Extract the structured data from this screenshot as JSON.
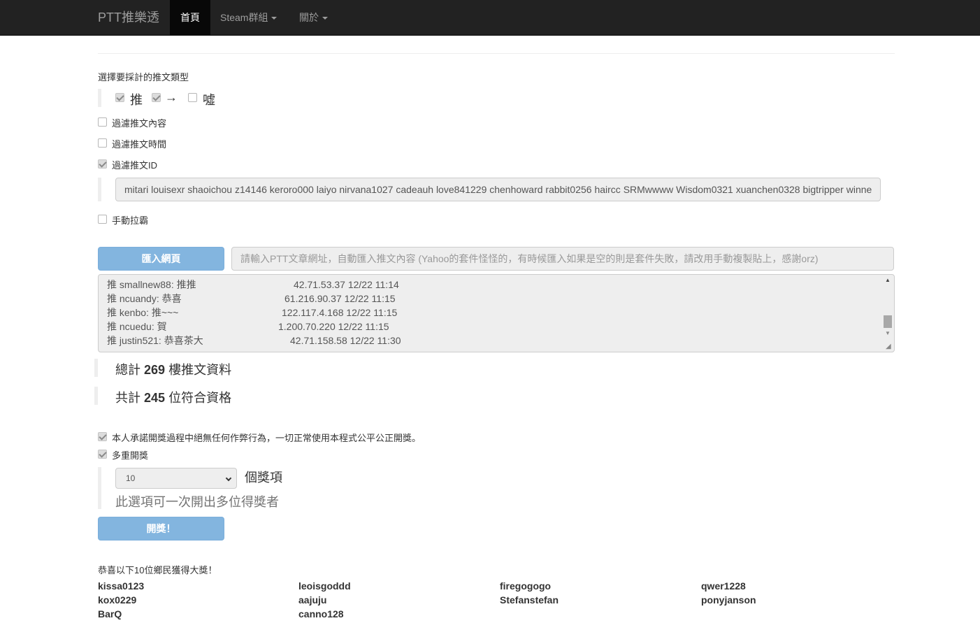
{
  "navbar": {
    "brand": "PTT推樂透",
    "items": [
      {
        "label": "首頁",
        "active": true
      },
      {
        "label": "Steam群組",
        "dropdown": true
      },
      {
        "label": "關於",
        "dropdown": true
      }
    ]
  },
  "filters": {
    "heading": "選擇要採計的推文類型",
    "types": [
      {
        "label": "推",
        "checked": true
      },
      {
        "label": "→",
        "checked": true
      },
      {
        "label": "噓",
        "checked": false
      }
    ],
    "filter_content": {
      "label": "過濾推文內容",
      "checked": false
    },
    "filter_time": {
      "label": "過濾推文時間",
      "checked": false
    },
    "filter_id": {
      "label": "過濾推文ID",
      "checked": true
    },
    "id_list_value": "mitari louisexr shaoichou z14146 keroro000 laiyo nirvana1027 cadeauh love841229 chenhoward rabbit0256 haircc SRMwwww Wisdom0321 xuanchen0328 bigtripper winne",
    "manual_pull": {
      "label": "手動拉霸",
      "checked": false
    }
  },
  "import": {
    "button_label": "匯入網頁",
    "url_placeholder": "請輸入PTT文章網址，自動匯入推文內容 (Yahoo的套件怪怪的，有時候匯入如果是空的則是套件失敗，請改用手動複製貼上，感謝orz)"
  },
  "pushes": [
    {
      "text": "推 smallnew88: 推推",
      "meta": "42.71.53.37 12/22 11:14"
    },
    {
      "text": "推 ncuandy: 恭喜",
      "meta": "61.216.90.37 12/22 11:15"
    },
    {
      "text": "推 kenbo: 推~~~",
      "meta": "122.117.4.168 12/22 11:15"
    },
    {
      "text": "推 ncuedu: 賀",
      "meta": "1.200.70.220 12/22 11:15"
    },
    {
      "text": "推 justin521: 恭喜茶大",
      "meta": "42.71.158.58 12/22 11:30"
    }
  ],
  "stats": {
    "total_prefix": "總計",
    "total_count": "269",
    "total_suffix": "樓推文資料",
    "eligible_prefix": "共計",
    "eligible_count": "245",
    "eligible_suffix": "位符合資格"
  },
  "draw": {
    "pledge": {
      "label": "本人承諾開獎過程中絕無任何作弊行為，一切正常使用本程式公平公正開獎。",
      "checked": true
    },
    "multi": {
      "label": "多重開獎",
      "checked": true
    },
    "prize_count": "10",
    "prize_unit": "個獎項",
    "help_text": "此選項可一次開出多位得獎者",
    "button_label": "開獎！"
  },
  "results": {
    "heading": "恭喜以下10位鄉民獲得大獎！",
    "winners": [
      "kissa0123",
      "leoisgoddd",
      "firegogogo",
      "qwer1228",
      "kox0229",
      "aajuju",
      "Stefanstefan",
      "ponyjanson",
      "BarQ",
      "canno128"
    ]
  }
}
